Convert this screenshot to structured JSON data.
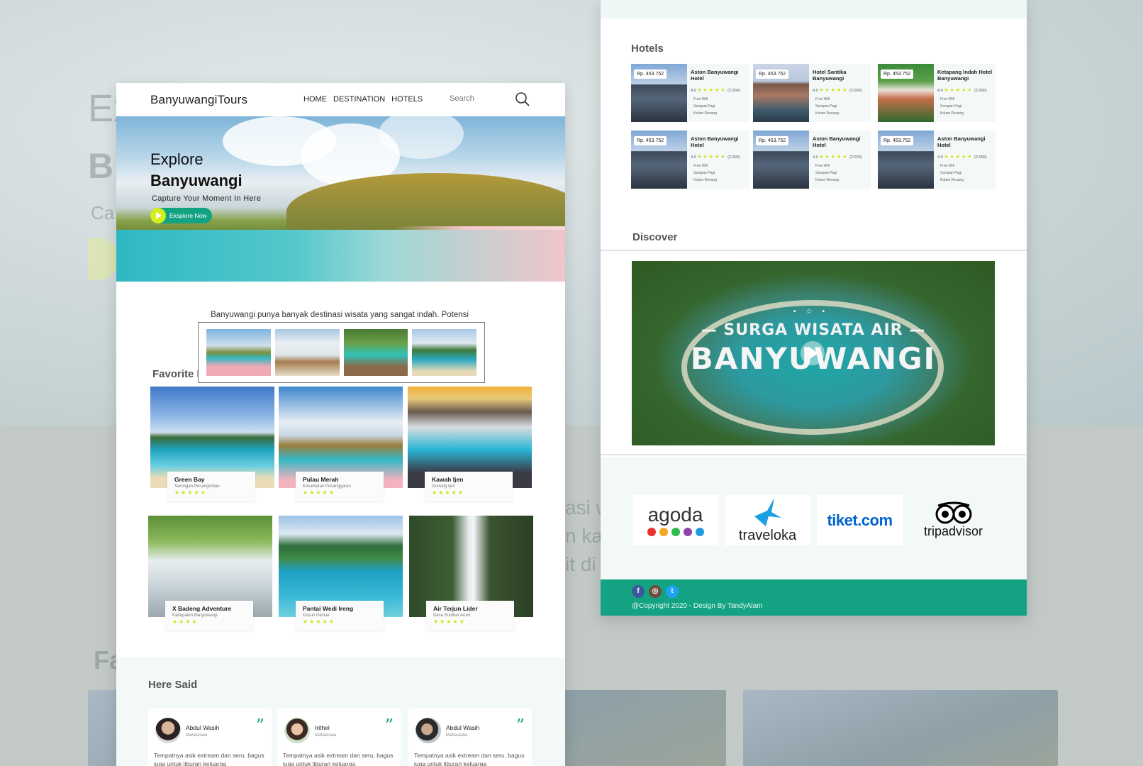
{
  "nav": {
    "brand": "BanyuwangiTours",
    "links": [
      "HOME",
      "DESTINATION",
      "HOTELS"
    ],
    "search_placeholder": "Search"
  },
  "hero": {
    "line1": "Explore",
    "line2": "Banyuwangi",
    "tagline": "Capture Your Moment In Here",
    "button": "Eksplore Now"
  },
  "intro": "Banyuwangi punya banyak  destinasi wisata yang sangat indah. Potensi wisatanya sangat tinggi. Tak heran kalau Banyuwangi jadi salah satu destinasi favorit di Jawa Timur.",
  "favorite": {
    "title": "Favorite Destination",
    "items": [
      {
        "name": "Green Bay",
        "sub": "Sarongan-Pesangrahan",
        "stars": "★★★★★"
      },
      {
        "name": "Pulau Merah",
        "sub": "Kecamatan Pesanggaran",
        "stars": "★★★★★"
      },
      {
        "name": "Kawah Ijen",
        "sub": "Gunung Ijen",
        "stars": "★★★★★"
      },
      {
        "name": "X Badeng Adventure",
        "sub": "Kabupaten Banyuwangi",
        "stars": "★★★★"
      },
      {
        "name": "Pantai Wedi Ireng",
        "sub": "Dusun Pancer",
        "stars": "★★★★★"
      },
      {
        "name": "Air Terjun Lider",
        "sub": "Desa Sumber Arum",
        "stars": "★★★★★"
      }
    ]
  },
  "said": {
    "title": "Here Said",
    "items": [
      {
        "name": "Abdul Wasih",
        "role": "Mahasiswa",
        "text": "Tempatnya asik extream dan seru, bagus juga untuk liburan keluarga"
      },
      {
        "name": "Irithel",
        "role": "Mahasiswa",
        "text": "Tempatnya asik extream dan seru, bagus juga untuk liburan keluarga"
      },
      {
        "name": "Abdul Wasih",
        "role": "Mahasiswa",
        "text": "Tempatnya asik extream dan seru, bagus juga untuk liburan keluarga"
      }
    ]
  },
  "hotels": {
    "title": "Hotels",
    "items": [
      {
        "price": "Rp. 453.752",
        "name": "Aston Banyuwangi Hotel",
        "rating": "4.0",
        "reviews": "(2.000)",
        "amenities": [
          "Free Wifi",
          "Sarapan Pagi",
          "Kolam Renang"
        ]
      },
      {
        "price": "Rp. 453.752",
        "name": "Hotel Santika Banyuwangi",
        "rating": "4.0",
        "reviews": "(2.000)",
        "amenities": [
          "Free Wifi",
          "Sarapan Pagi",
          "Kolam Renang"
        ]
      },
      {
        "price": "Rp. 453.752",
        "name": "Ketapang Indah Hotel Banyuwangi",
        "rating": "4.0",
        "reviews": "(2.000)",
        "amenities": [
          "Free Wifi",
          "Sarapan Pagi",
          "Kolam Renang"
        ]
      },
      {
        "price": "Rp. 453.752",
        "name": "Aston Banyuwangi Hotel",
        "rating": "4.0",
        "reviews": "(2.000)",
        "amenities": [
          "Free Wifi",
          "Sarapan Pagi",
          "Kolam Renang"
        ]
      },
      {
        "price": "Rp. 453.752",
        "name": "Aston Banyuwangi Hotel",
        "rating": "4.0",
        "reviews": "(2.000)",
        "amenities": [
          "Free Wifi",
          "Sarapan Pagi",
          "Kolam Renang"
        ]
      },
      {
        "price": "Rp. 453.752",
        "name": "Aston Banyuwangi Hotel",
        "rating": "4.0",
        "reviews": "(2.000)",
        "amenities": [
          "Free Wifi",
          "Sarapan Pagi",
          "Kolam Renang"
        ]
      }
    ]
  },
  "discover": {
    "title": "Discover",
    "video_line1": "— SURGA WISATA AIR —",
    "video_line2": "BANYUWANGI"
  },
  "partners": [
    "agoda",
    "traveloka",
    "tiket.com",
    "tripadvisor"
  ],
  "footer": {
    "social": [
      "facebook-icon",
      "instagram-icon",
      "twitter-icon"
    ],
    "copyright": "@Copyright 2020 - Design By TandyAlam"
  },
  "colors": {
    "accent": "#12a383",
    "star": "#d0e21a",
    "footer": "#13a382"
  },
  "background": {
    "ghost_text": [
      "Ex",
      "B",
      "Ca",
      "Fa",
      "asi w",
      "n ka",
      "it di"
    ]
  }
}
